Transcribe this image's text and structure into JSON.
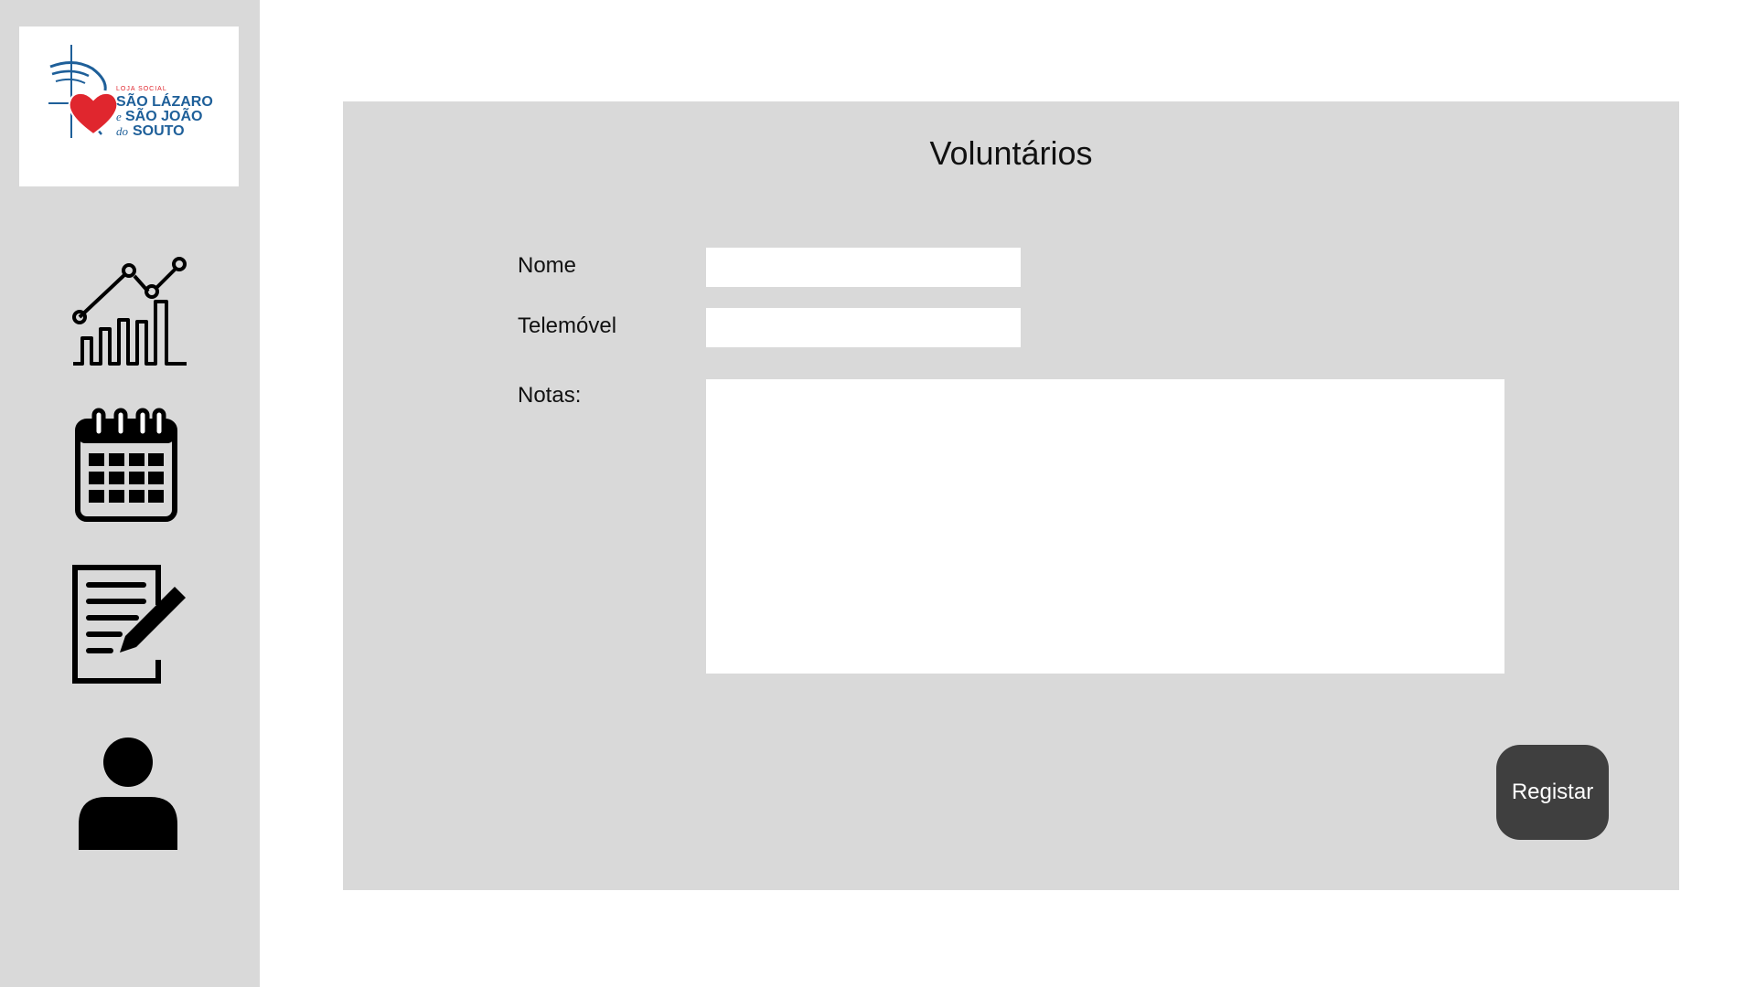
{
  "logo": {
    "line1": "LOJA SOCIAL",
    "line2": "SÃO LÁZARO",
    "line3_prefix": "e",
    "line3": "SÃO JOÃO",
    "line4_prefix": "do",
    "line4": "SOUTO"
  },
  "sidebar": {
    "items": [
      {
        "icon": "chart-icon"
      },
      {
        "icon": "calendar-icon"
      },
      {
        "icon": "document-edit-icon"
      },
      {
        "icon": "user-icon"
      }
    ]
  },
  "form": {
    "title": "Voluntários",
    "nome_label": "Nome",
    "nome_value": "",
    "telemovel_label": "Telemóvel",
    "telemovel_value": "",
    "notas_label": "Notas:",
    "notas_value": "",
    "submit_label": "Registar"
  },
  "colors": {
    "sidebar_bg": "#d9d9d9",
    "panel_bg": "#d9d9d9",
    "button_bg": "#3f3f3f",
    "logo_blue": "#1e5f99",
    "logo_red": "#e0262e"
  }
}
